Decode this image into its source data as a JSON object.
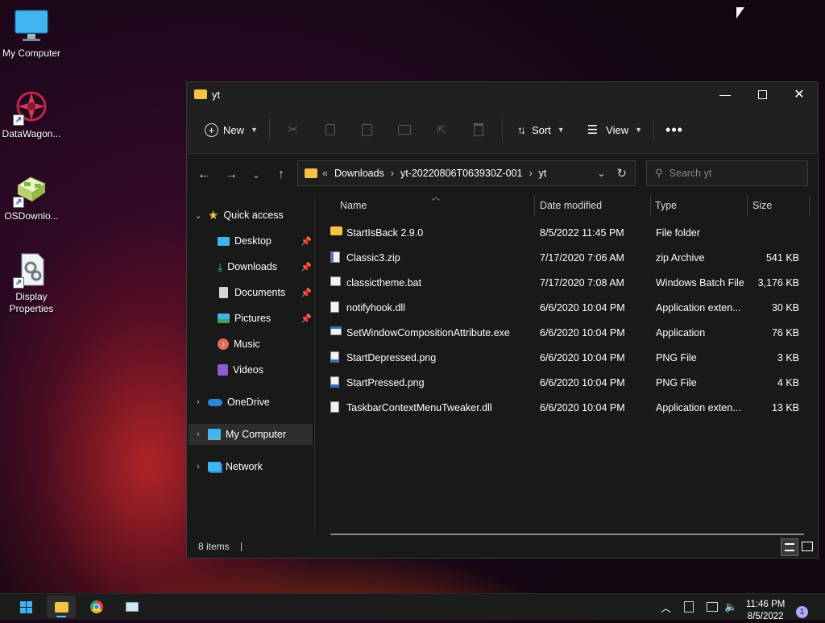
{
  "desktop": {
    "icons": [
      {
        "label": "My Computer"
      },
      {
        "label": "DataWagon..."
      },
      {
        "label": "OSDownlo..."
      },
      {
        "label": "Display Properties"
      }
    ]
  },
  "window": {
    "title": "yt",
    "commands": {
      "new": "New",
      "sort": "Sort",
      "view": "View"
    },
    "address": {
      "crumbs": [
        "Downloads",
        "yt-20220806T063930Z-001",
        "yt"
      ],
      "overflow": "«"
    },
    "search_placeholder": "Search yt",
    "nav": {
      "quick_access": "Quick access",
      "items": [
        {
          "label": "Desktop",
          "pinned": true
        },
        {
          "label": "Downloads",
          "pinned": true
        },
        {
          "label": "Documents",
          "pinned": true
        },
        {
          "label": "Pictures",
          "pinned": true
        },
        {
          "label": "Music",
          "pinned": false
        },
        {
          "label": "Videos",
          "pinned": false
        }
      ],
      "onedrive": "OneDrive",
      "my_computer": "My Computer",
      "network": "Network"
    },
    "columns": {
      "name": "Name",
      "date": "Date modified",
      "type": "Type",
      "size": "Size"
    },
    "files": [
      {
        "name": "StartIsBack 2.9.0",
        "date": "8/5/2022 11:45 PM",
        "type": "File folder",
        "size": "",
        "icon": "folder-icon"
      },
      {
        "name": "Classic3.zip",
        "date": "7/17/2020 7:06 AM",
        "type": "zip Archive",
        "size": "541 KB",
        "icon": "zip-icon"
      },
      {
        "name": "classictheme.bat",
        "date": "7/17/2020 7:08 AM",
        "type": "Windows Batch File",
        "size": "3,176 KB",
        "icon": "batch-icon"
      },
      {
        "name": "notifyhook.dll",
        "date": "6/6/2020 10:04 PM",
        "type": "Application exten...",
        "size": "30 KB",
        "icon": "dll-icon"
      },
      {
        "name": "SetWindowCompositionAttribute.exe",
        "date": "6/6/2020 10:04 PM",
        "type": "Application",
        "size": "76 KB",
        "icon": "exe-icon"
      },
      {
        "name": "StartDepressed.png",
        "date": "6/6/2020 10:04 PM",
        "type": "PNG File",
        "size": "3 KB",
        "icon": "png-icon"
      },
      {
        "name": "StartPressed.png",
        "date": "6/6/2020 10:04 PM",
        "type": "PNG File",
        "size": "4 KB",
        "icon": "png-icon"
      },
      {
        "name": "TaskbarContextMenuTweaker.dll",
        "date": "6/6/2020 10:04 PM",
        "type": "Application exten...",
        "size": "13 KB",
        "icon": "dll-icon"
      }
    ],
    "status": "8 items"
  },
  "taskbar": {
    "time": "11:46 PM",
    "date": "8/5/2022",
    "notification_count": "1"
  },
  "colors": {
    "accent": "#4cc2ff",
    "folder": "#f5c344",
    "window_bg": "#191919"
  }
}
